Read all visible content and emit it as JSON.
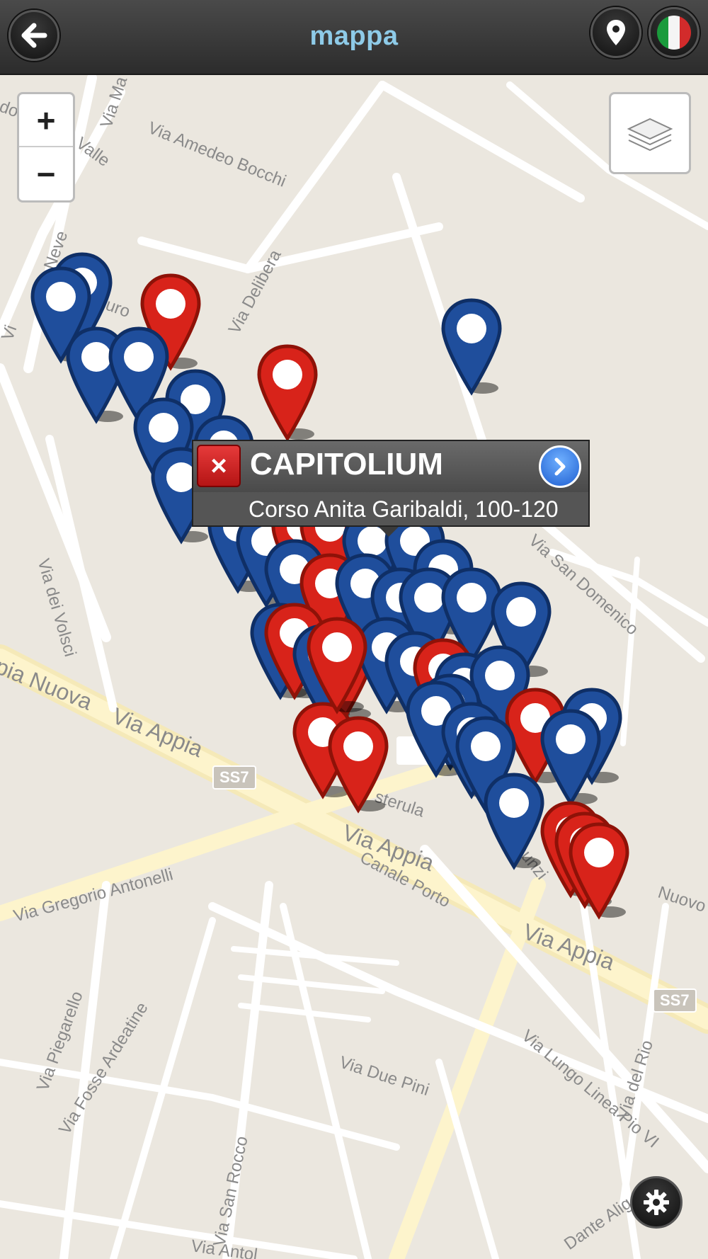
{
  "header": {
    "title": "mappa",
    "back_icon": "arrow-left-icon",
    "location_icon": "map-pin-icon",
    "language_flag": "italy-flag-icon"
  },
  "map": {
    "zoom_in_label": "+",
    "zoom_out_label": "−",
    "layers_icon": "layers-icon",
    "settings_icon": "gear-icon",
    "streets": [
      "Via Amedeo Bocchi",
      "Valle",
      "Via Ma",
      "Via Delibera",
      "Via dei Volsci",
      "Via San Domenico",
      "pia Nuova",
      "Via Appia",
      "Via Appia",
      "Via Appia",
      "Via Gregorio Antonelli",
      "Canale Porto",
      "Via Piegarello",
      "Via Fosse Ardeatine",
      "Via Due Pini",
      "Via San Rocco",
      "Via Lungo Linea Pio VI",
      "Via del Rio",
      "Via Annunzi",
      "Nuovo",
      "Dante Alig",
      "Via Antol",
      "sterula",
      "uro",
      "Vi",
      "dor",
      "Neve",
      "Vi"
    ],
    "shields": [
      "SS7",
      "SS7"
    ],
    "pin_colors": {
      "blue": "#1f4e9c",
      "red": "#d8231a"
    }
  },
  "popup": {
    "name": "CAPITOLIUM",
    "address": "Corso Anita Garibaldi, 100-120",
    "close_icon": "close-icon",
    "close_glyph": "×",
    "go_icon": "chevron-right-icon"
  }
}
